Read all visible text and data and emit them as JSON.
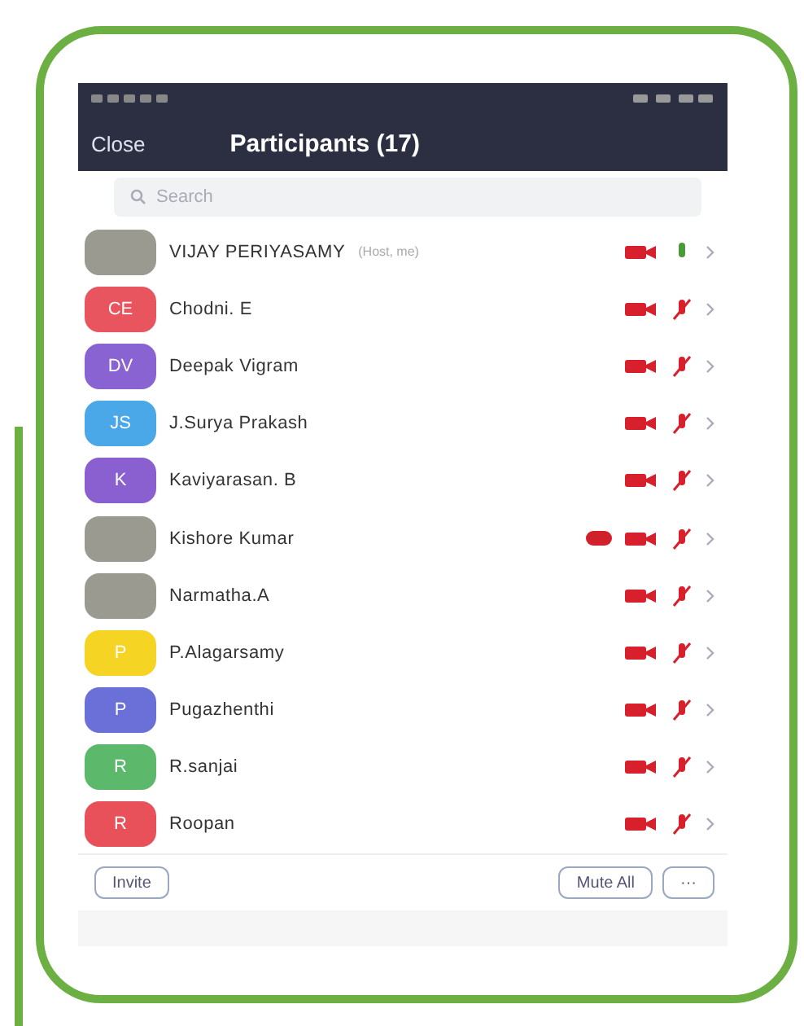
{
  "header": {
    "close": "Close",
    "title": "Participants (17)"
  },
  "search": {
    "placeholder": "Search"
  },
  "participants": [
    {
      "kind": "photo",
      "name": "VIJAY PERIYASAMY",
      "note": "(Host, me)",
      "muted": false,
      "badge": false
    },
    {
      "kind": "initials",
      "initials": "CE",
      "color": "#e8555f",
      "name": "Chodni. E",
      "muted": true,
      "badge": false
    },
    {
      "kind": "initials",
      "initials": "DV",
      "color": "#8a63d2",
      "name": "Deepak Vigram",
      "muted": true,
      "badge": false
    },
    {
      "kind": "initials",
      "initials": "JS",
      "color": "#4aa8e8",
      "name": "J.Surya Prakash",
      "muted": true,
      "badge": false
    },
    {
      "kind": "initials",
      "initials": "K",
      "color": "#8a5fd0",
      "name": "Kaviyarasan. B",
      "muted": true,
      "badge": false
    },
    {
      "kind": "photo",
      "name": "Kishore Kumar",
      "muted": true,
      "badge": true
    },
    {
      "kind": "photo",
      "name": "Narmatha.A",
      "muted": true,
      "badge": false
    },
    {
      "kind": "initials",
      "initials": "P",
      "color": "#f5d424",
      "name": "P.Alagarsamy",
      "muted": true,
      "badge": false
    },
    {
      "kind": "initials",
      "initials": "P",
      "color": "#6b6fd8",
      "name": "Pugazhenthi",
      "muted": true,
      "badge": false
    },
    {
      "kind": "initials",
      "initials": "R",
      "color": "#5cb86a",
      "name": "R.sanjai",
      "muted": true,
      "badge": false
    },
    {
      "kind": "initials",
      "initials": "R",
      "color": "#e8505a",
      "name": "Roopan",
      "muted": true,
      "badge": false
    }
  ],
  "footer": {
    "invite": "Invite",
    "mute_all": "Mute All",
    "more": "···"
  }
}
